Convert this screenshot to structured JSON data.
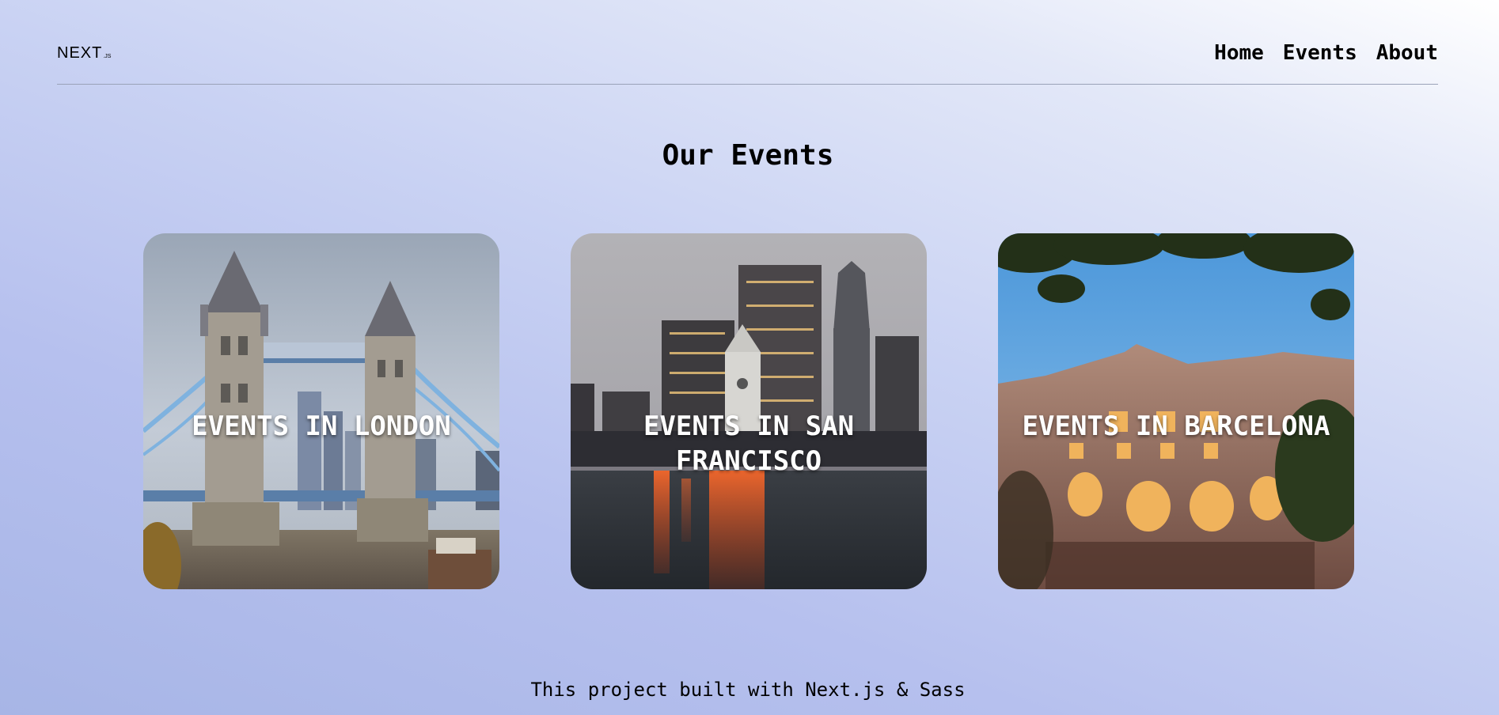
{
  "header": {
    "logo": {
      "main": "NEXT",
      "suffix": ".JS"
    },
    "nav": [
      {
        "label": "Home"
      },
      {
        "label": "Events"
      },
      {
        "label": "About"
      }
    ]
  },
  "main": {
    "title": "Our Events",
    "cards": [
      {
        "label": "EVENTS IN LONDON",
        "scene": "tower-bridge-photo"
      },
      {
        "label": "EVENTS IN SAN FRANCISCO",
        "scene": "san-francisco-skyline-photo"
      },
      {
        "label": "EVENTS IN BARCELONA",
        "scene": "casa-batllo-photo"
      }
    ]
  },
  "footer": {
    "text": "This project built with Next.js & Sass"
  },
  "colors": {
    "background_start": "#ffffff",
    "background_end": "#a7b5e6",
    "text": "#000000",
    "card_label": "#ffffff"
  }
}
